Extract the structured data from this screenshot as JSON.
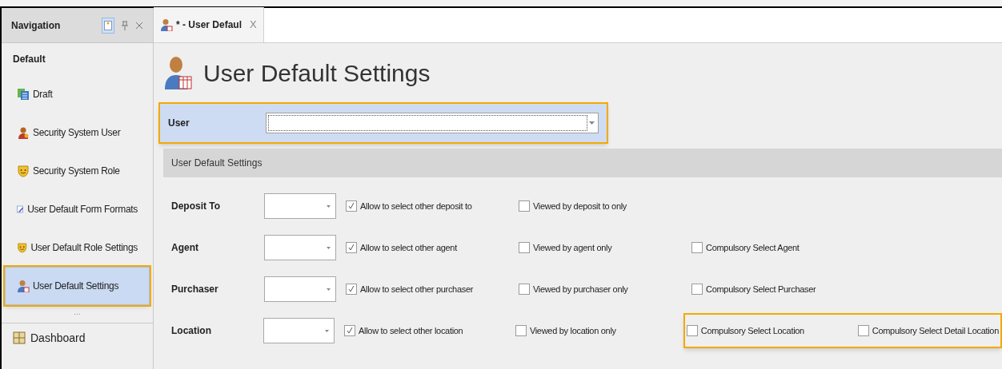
{
  "navigation": {
    "title": "Navigation",
    "group": "Default",
    "items": [
      {
        "label": "Draft",
        "selected": false,
        "highlighted": false
      },
      {
        "label": "Security System User",
        "selected": false,
        "highlighted": false
      },
      {
        "label": "Security System Role",
        "selected": false,
        "highlighted": false
      },
      {
        "label": "User Default Form Formats",
        "selected": false,
        "highlighted": false
      },
      {
        "label": "User Default Role Settings",
        "selected": false,
        "highlighted": false
      },
      {
        "label": "User Default Settings",
        "selected": true,
        "highlighted": true
      }
    ],
    "more": "...",
    "footer_item": {
      "label": "Dashboard"
    }
  },
  "tab": {
    "label": "* - User Defaul",
    "close": "X"
  },
  "page_title": "User Default Settings",
  "user_field": {
    "label": "User",
    "highlighted": true
  },
  "section": {
    "title": "User Default Settings",
    "rows": [
      {
        "label": "Deposit To",
        "allow": {
          "label": "Allow to select other deposit to",
          "checked": true
        },
        "viewed": {
          "label": "Viewed by deposit to only",
          "checked": false
        }
      },
      {
        "label": "Agent",
        "allow": {
          "label": "Allow to select other agent",
          "checked": true
        },
        "viewed": {
          "label": "Viewed by agent only",
          "checked": false
        },
        "compulsory": {
          "highlighted": false,
          "options": [
            {
              "label": "Compulsory Select Agent",
              "checked": false
            }
          ]
        }
      },
      {
        "label": "Purchaser",
        "allow": {
          "label": "Allow to select other purchaser",
          "checked": true
        },
        "viewed": {
          "label": "Viewed by purchaser only",
          "checked": false
        },
        "compulsory": {
          "highlighted": false,
          "options": [
            {
              "label": "Compulsory Select Purchaser",
              "checked": false
            }
          ]
        }
      },
      {
        "label": "Location",
        "allow": {
          "label": "Allow to select other location",
          "checked": true
        },
        "viewed": {
          "label": "Viewed by location only",
          "checked": false
        },
        "compulsory": {
          "highlighted": true,
          "options": [
            {
              "label": "Compulsory Select Location",
              "checked": false
            },
            {
              "label": "Compulsory Select Detail Location",
              "checked": false
            }
          ]
        }
      }
    ]
  }
}
